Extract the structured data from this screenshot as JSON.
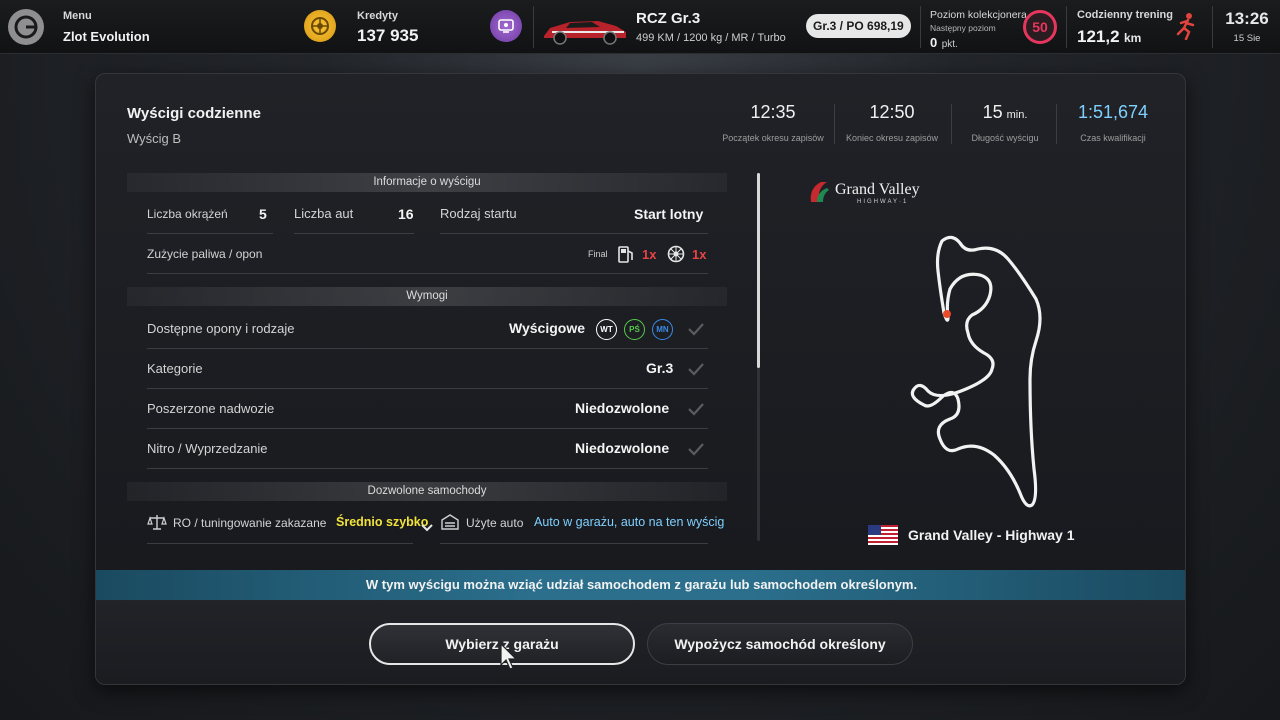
{
  "topbar": {
    "menu_label": "Menu",
    "menu_value": "Zlot Evolution",
    "credits_label": "Kredyty",
    "credits_value": "137 935",
    "car_name": "RCZ Gr.3",
    "car_specs": "499 KM / 1200 kg / MR / Turbo",
    "pp_badge": "Gr.3 / PO 698,19",
    "collector_label": "Poziom kolekcjonera",
    "collector_next_label": "Następny poziom",
    "collector_points": "0",
    "collector_points_unit": "pkt.",
    "collector_level": "50",
    "training_label": "Codzienny trening",
    "training_value": "121,2",
    "training_unit": "km",
    "time": "13:26",
    "date": "15 Sie",
    "colors": {
      "level": "#e7365e",
      "training_icon": "#e0443c",
      "credits_icon": "#f6c23a",
      "util_icon": "#8a52bf"
    }
  },
  "header": {
    "title": "Wyścigi codzienne",
    "subtitle": "Wyścig B",
    "stats": [
      {
        "value": "12:35",
        "unit": "",
        "label": "Początek okresu zapisów"
      },
      {
        "value": "12:50",
        "unit": "",
        "label": "Koniec okresu zapisów"
      },
      {
        "value": "15",
        "unit": "min.",
        "label": "Długość wyścigu"
      },
      {
        "value": "1:51,674",
        "unit": "",
        "label": "Czas kwalifikacji"
      }
    ],
    "accent": "#7fd0ff"
  },
  "race_info": {
    "section_title": "Informacje o wyścigu",
    "laps_label": "Liczba okrążeń",
    "laps_value": "5",
    "cars_label": "Liczba aut",
    "cars_value": "16",
    "start_label": "Rodzaj startu",
    "start_value": "Start lotny",
    "wear_label": "Zużycie paliwa / opon",
    "wear_final": "Final",
    "fuel_mult": "1x",
    "tyre_mult": "1x"
  },
  "requirements": {
    "section_title": "Wymogi",
    "rows": [
      {
        "label": "Dostępne opony i rodzaje",
        "value": "Wyścigowe"
      },
      {
        "label": "Kategorie",
        "value": "Gr.3"
      },
      {
        "label": "Poszerzone nadwozie",
        "value": "Niedozwolone"
      },
      {
        "label": "Nitro / Wyprzedzanie",
        "value": "Niedozwolone"
      }
    ],
    "tire_tags": [
      {
        "text": "WT",
        "color": "#ffffff"
      },
      {
        "text": "PŚ",
        "color": "#58c94b"
      },
      {
        "text": "MN",
        "color": "#3a8ae6"
      }
    ]
  },
  "allowed_cars": {
    "section_title": "Dozwolone samochody",
    "bop_label": "RO / tuningowanie zakazane",
    "bop_value": "Średnio szybko",
    "used_label": "Użyte auto",
    "used_value": "Auto w garażu, auto na ten wyścig",
    "colors": {
      "bop": "#f2e33a",
      "used": "#7fd0ff"
    }
  },
  "track": {
    "logo_main": "Grand Valley",
    "logo_sub": "HIGHWAY·1",
    "name": "Grand Valley - Highway 1"
  },
  "info_strip": "W tym wyścigu można wziąć udział samochodem z garażu lub samochodem określonym.",
  "buttons": {
    "garage": "Wybierz z garażu",
    "rent": "Wypożycz samochód określony"
  }
}
